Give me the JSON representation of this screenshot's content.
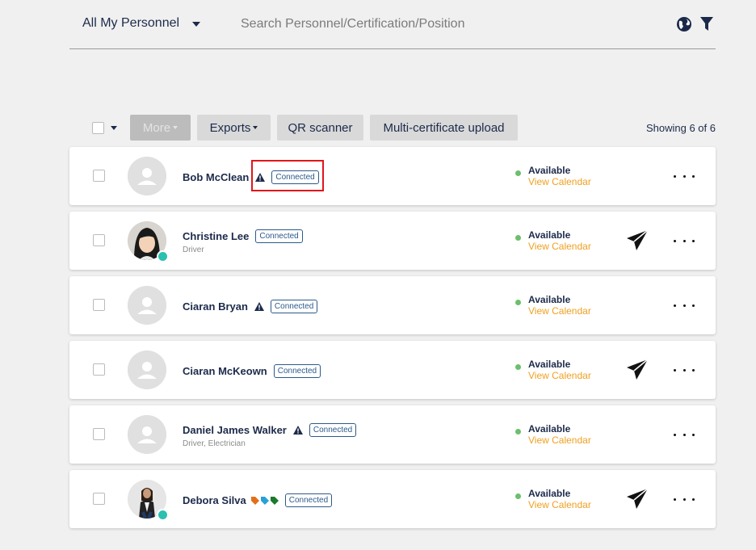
{
  "filter": {
    "label": "All My Personnel"
  },
  "search": {
    "placeholder": "Search Personnel/Certification/Position"
  },
  "icons": {
    "globe": "globe-icon",
    "filter": "filter-icon"
  },
  "toolbar": {
    "more_label": "More",
    "exports_label": "Exports",
    "qr_label": "QR scanner",
    "multi_label": "Multi-certificate upload",
    "showing": "Showing 6 of 6"
  },
  "colors": {
    "navy": "#1c2a4a",
    "calendar": "#f0a020",
    "available": "#6cbf6c",
    "verified": "#2bc0b0",
    "highlight": "#e0161b"
  },
  "rows": [
    {
      "name": "Bob McClean",
      "badge": "Connected",
      "subtitle": "",
      "status": "Available",
      "calendar": "View Calendar"
    },
    {
      "name": "Christine Lee",
      "badge": "Connected",
      "subtitle": "Driver",
      "status": "Available",
      "calendar": "View Calendar"
    },
    {
      "name": "Ciaran Bryan",
      "badge": "Connected",
      "subtitle": "",
      "status": "Available",
      "calendar": "View Calendar"
    },
    {
      "name": "Ciaran McKeown",
      "badge": "Connected",
      "subtitle": "",
      "status": "Available",
      "calendar": "View Calendar"
    },
    {
      "name": "Daniel James Walker",
      "badge": "Connected",
      "subtitle": "Driver, Electrician",
      "status": "Available",
      "calendar": "View Calendar"
    },
    {
      "name": "Debora Silva",
      "badge": "Connected",
      "subtitle": "",
      "status": "Available",
      "calendar": "View Calendar"
    }
  ]
}
